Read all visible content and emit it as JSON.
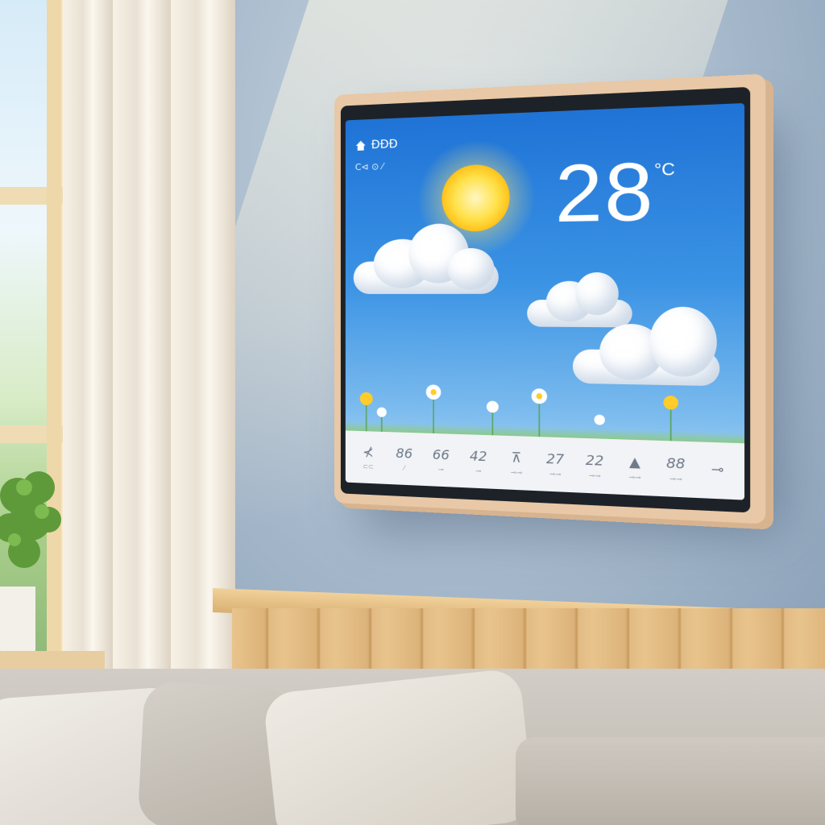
{
  "device": {
    "status_top": "ĐĐĐ",
    "status_sub": "C⊲ ⊙ ⁄",
    "temperature": "28",
    "unit": "°C"
  },
  "forecast": [
    {
      "value": "⊀",
      "sub": "⊂⊂"
    },
    {
      "value": "86",
      "sub": "⁄"
    },
    {
      "value": "66",
      "sub": "⊸"
    },
    {
      "value": "42",
      "sub": "⊸"
    },
    {
      "value": "⊼",
      "sub": "⊸⊸"
    },
    {
      "value": "27",
      "sub": "⊸⊸"
    },
    {
      "value": "22",
      "sub": "⊸⊸"
    },
    {
      "value": "▲",
      "sub": "⊸⊸"
    },
    {
      "value": "88",
      "sub": "⊸⊸"
    },
    {
      "value": "⊸",
      "sub": ""
    }
  ],
  "colors": {
    "screen_sky": "#3b93e4",
    "frame": "#e8c8a6",
    "wall": "#a9bbcd",
    "wood": "#e2bb84"
  },
  "icons": [
    "home-icon",
    "sun-icon",
    "cloud-icon",
    "flower-icon"
  ]
}
